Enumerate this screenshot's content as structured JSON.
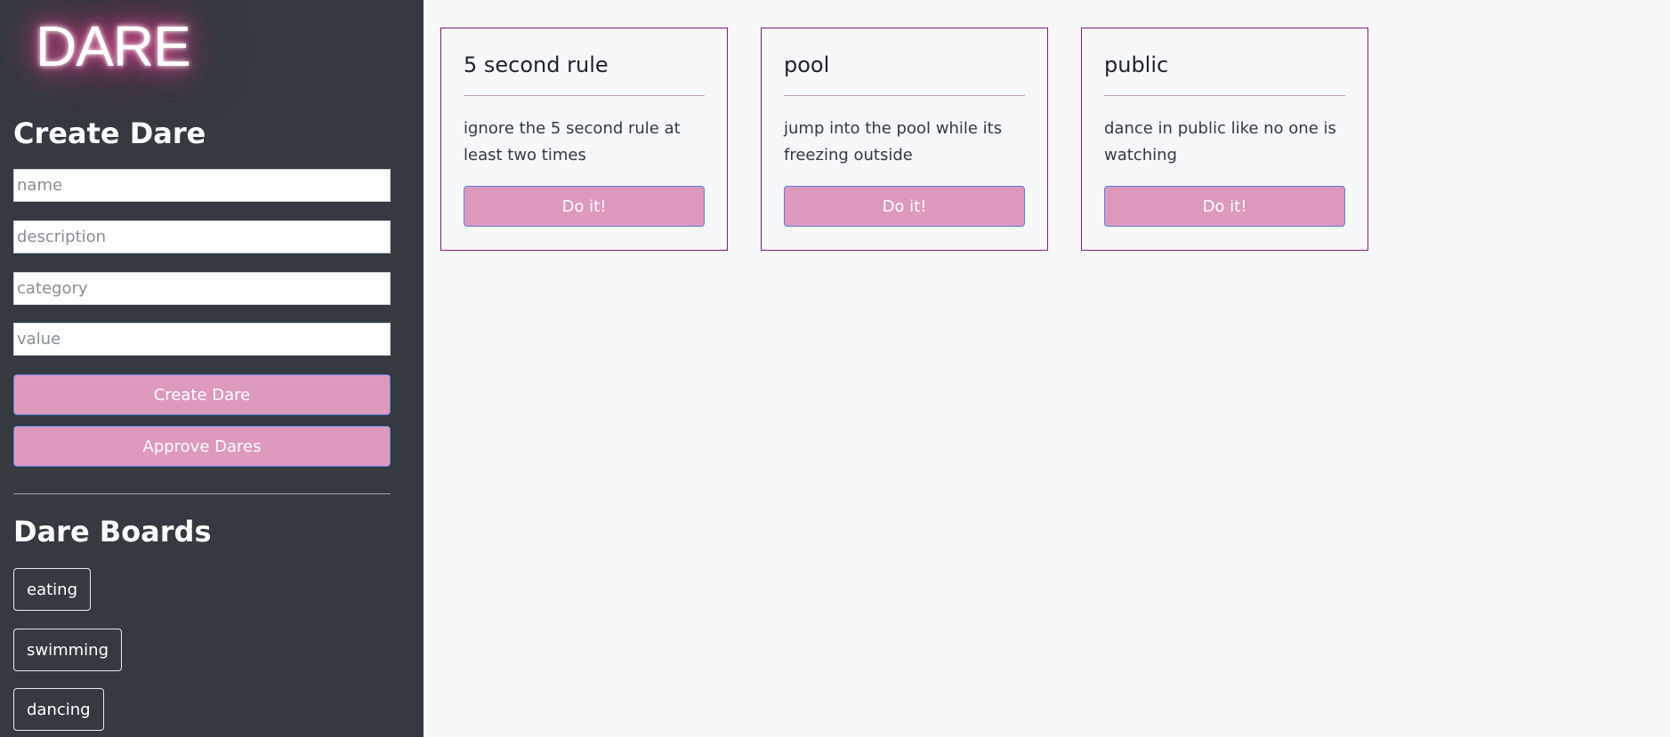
{
  "sidebar": {
    "logo_text": "DARE",
    "create_title": "Create Dare",
    "fields": {
      "name_placeholder": "name",
      "description_placeholder": "description",
      "category_placeholder": "category",
      "value_placeholder": "value"
    },
    "create_button": "Create Dare",
    "approve_button": "Approve Dares",
    "boards_title": "Dare Boards",
    "boards": [
      "eating",
      "swimming",
      "dancing"
    ]
  },
  "cards": [
    {
      "title": "5 second rule",
      "description": "ignore the 5 second rule at least two times",
      "button": "Do it!"
    },
    {
      "title": "pool",
      "description": "jump into the pool while its freezing outside",
      "button": "Do it!"
    },
    {
      "title": "public",
      "description": "dance in public like no one is watching",
      "button": "Do it!"
    }
  ],
  "colors": {
    "sidebar_bg": "#343a40",
    "page_bg": "#f7f8fa",
    "accent_pink": "#dd99bb",
    "card_border": "#8a1b7a",
    "logo_glow": "#d9498d"
  }
}
